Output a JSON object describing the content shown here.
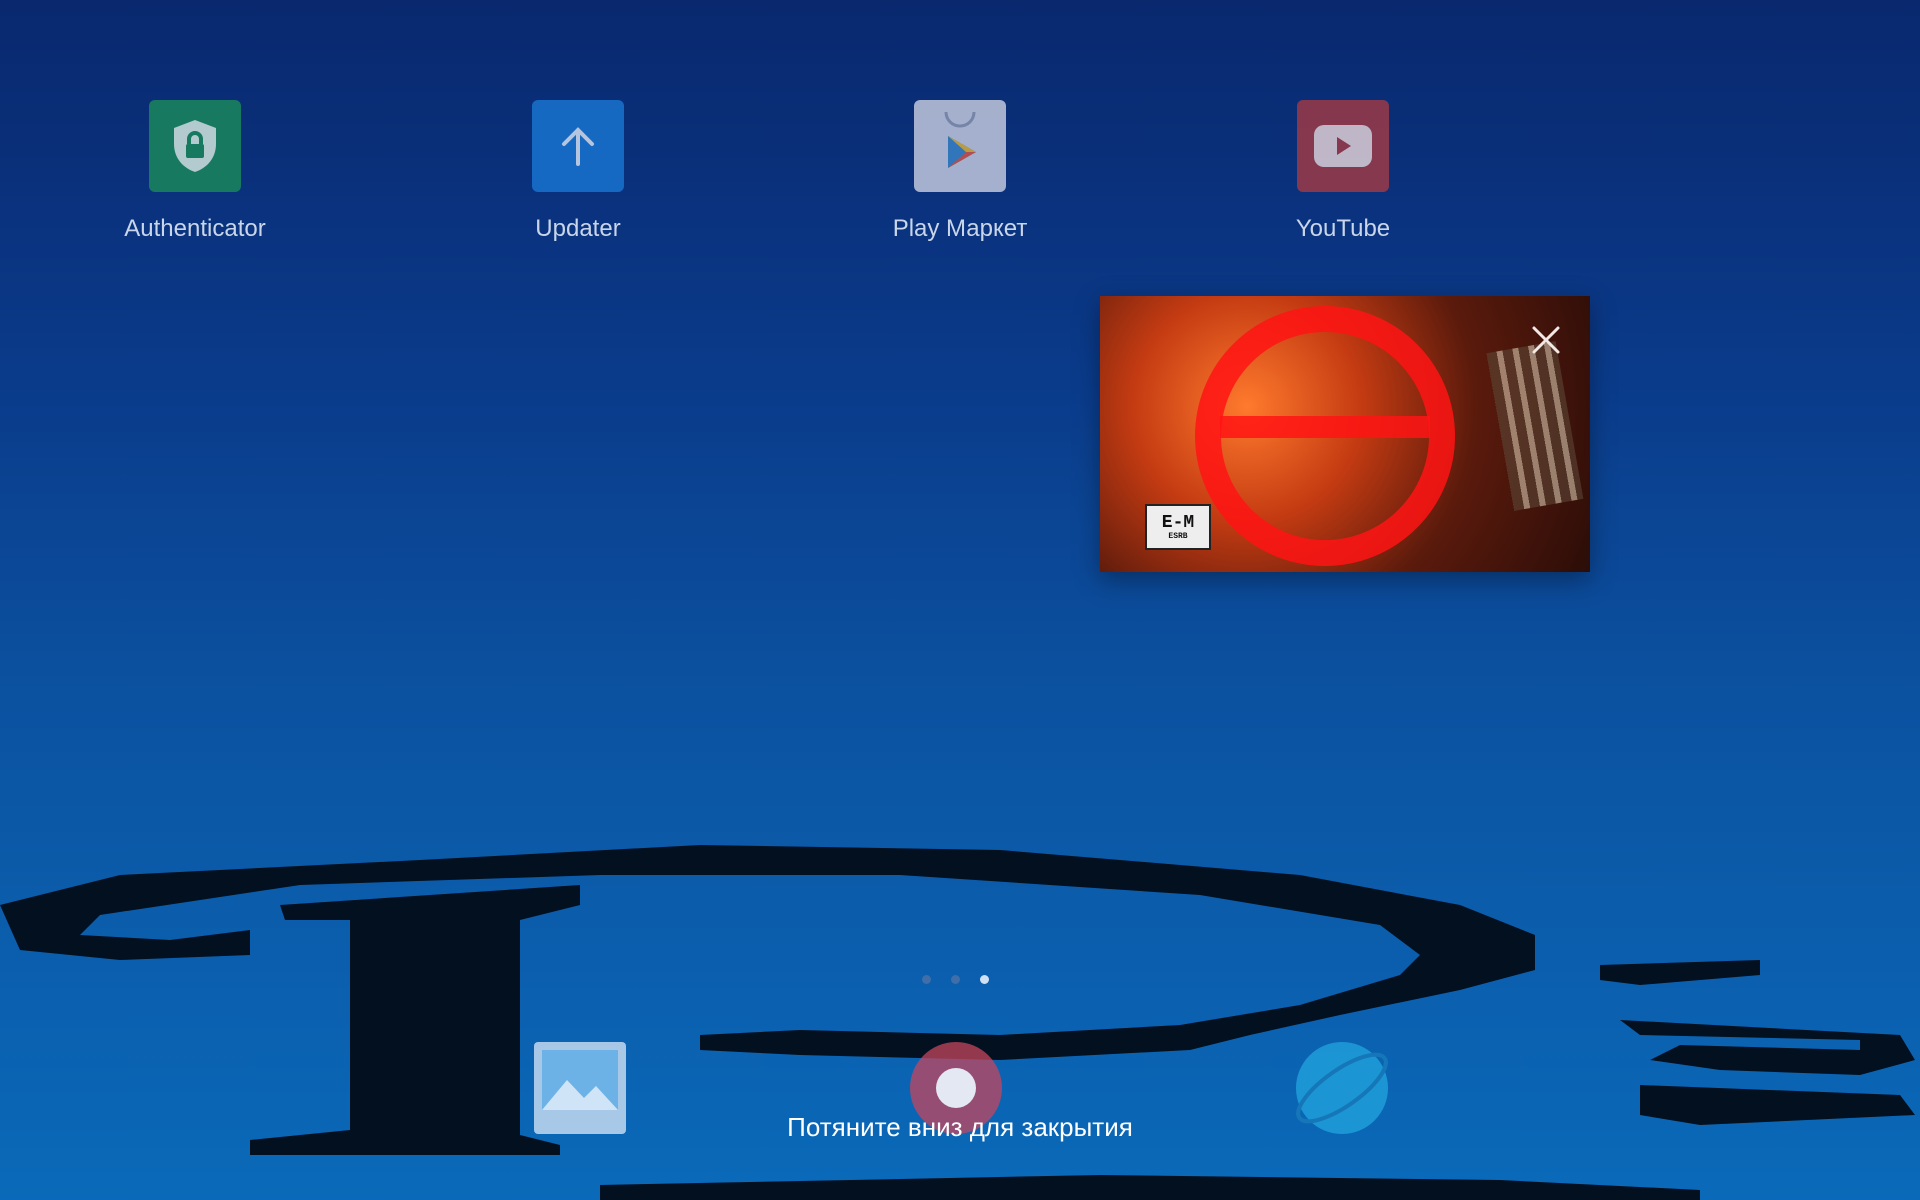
{
  "apps": [
    {
      "label": "Authenticator",
      "icon": "shield-lock-icon"
    },
    {
      "label": "Updater",
      "icon": "arrow-up-icon"
    },
    {
      "label": "Play Маркет",
      "icon": "play-store-icon"
    },
    {
      "label": "YouTube",
      "icon": "youtube-icon"
    }
  ],
  "pip": {
    "rating": "E-M",
    "rating_sub": "ESRB",
    "close_icon": "close-icon"
  },
  "page_indicator": {
    "count": 3,
    "active_index": 2
  },
  "dock": [
    {
      "icon": "gallery-icon"
    },
    {
      "icon": "camera-icon"
    },
    {
      "icon": "browser-icon"
    }
  ],
  "hint": "Потяните вниз для закрытия"
}
